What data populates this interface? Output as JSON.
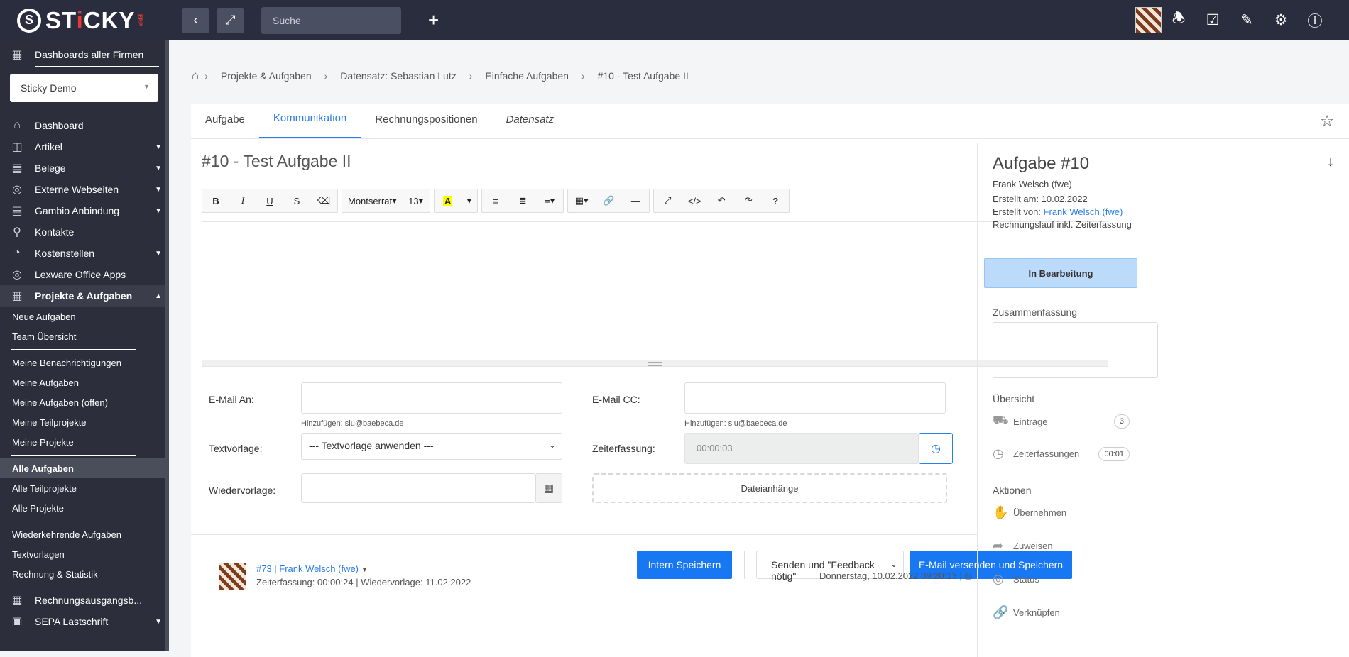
{
  "topbar": {
    "logo_text_a": "ST",
    "logo_text_b": "i",
    "logo_text_c": "CKY",
    "logo_suffix": "ERP",
    "search_placeholder": "Suche"
  },
  "sidebar": {
    "dashboards_all": "Dashboards aller Firmen",
    "company": "Sticky Demo",
    "items": [
      {
        "label": "Dashboard",
        "icon": "home-icon"
      },
      {
        "label": "Artikel",
        "icon": "box-icon"
      },
      {
        "label": "Belege",
        "icon": "document-icon"
      },
      {
        "label": "Externe Webseiten",
        "icon": "globe-icon"
      },
      {
        "label": "Gambio Anbindung",
        "icon": "document-icon"
      },
      {
        "label": "Kontakte",
        "icon": "contact-icon"
      },
      {
        "label": "Kostenstellen",
        "icon": "pie-chart-icon"
      },
      {
        "label": "Lexware Office Apps",
        "icon": "globe-icon"
      },
      {
        "label": "Projekte & Aufgaben",
        "icon": "notebook-icon"
      }
    ],
    "sub_group1": [
      "Neue Aufgaben",
      "Team Übersicht"
    ],
    "sub_group2": [
      "Meine Benachrichtigungen",
      "Meine Aufgaben",
      "Meine Aufgaben (offen)",
      "Meine Teilprojekte",
      "Meine Projekte"
    ],
    "sub_group3": [
      "Alle Aufgaben",
      "Alle Teilprojekte",
      "Alle Projekte"
    ],
    "sub_group4": [
      "Wiederkehrende Aufgaben",
      "Textvorlagen",
      "Rechnung & Statistik"
    ],
    "bottom_items": [
      {
        "label": "Rechnungsausgangsb...",
        "icon": "table-icon"
      },
      {
        "label": "SEPA Lastschrift",
        "icon": "card-icon"
      }
    ]
  },
  "breadcrumb": [
    "Projekte & Aufgaben",
    "Datensatz: Sebastian Lutz",
    "Einfache Aufgaben",
    "#10 - Test Aufgabe II"
  ],
  "tabs": [
    "Aufgabe",
    "Kommunikation",
    "Rechnungspositionen",
    "Datensatz"
  ],
  "task_title": "#10 - Test Aufgabe II",
  "toolbar": {
    "font": "Montserrat",
    "size": "13",
    "bold": "B",
    "italic": "I",
    "underline": "U",
    "strike": "S",
    "color": "A",
    "code": "</>",
    "help": "?"
  },
  "form": {
    "email_to_label": "E-Mail An:",
    "email_to_hint": "Hinzufügen: slu@baebeca.de",
    "email_cc_label": "E-Mail CC:",
    "email_cc_hint": "Hinzufügen: slu@baebeca.de",
    "template_label": "Textvorlage:",
    "template_value": "--- Textvorlage anwenden ---",
    "time_label": "Zeiterfassung:",
    "time_value": "00:00:03",
    "resub_label": "Wiedervorlage:",
    "attachments": "Dateianhänge",
    "save_internal": "Intern Speichern",
    "send_option": "Senden und \"Feedback nötig\"",
    "send_save": "E-Mail versenden und Speichern"
  },
  "comment": {
    "header": "#73 | Frank Welsch (fwe)",
    "meta": "Zeiterfassung: 00:00:24 | Wiedervorlage: 11.02.2022",
    "date": "Donnerstag, 10.02.2022 09:20:13 |"
  },
  "right_panel": {
    "title": "Aufgabe #10",
    "owner": "Frank Welsch (fwe)",
    "created_at": "Erstellt am: 10.02.2022",
    "created_by_label": "Erstellt von:",
    "created_by": "Frank Welsch (fwe)",
    "billing": "Rechnungslauf inkl. Zeiterfassung",
    "status": "In Bearbeitung",
    "summary_label": "Zusammenfassung",
    "overview_label": "Übersicht",
    "entries_label": "Einträge",
    "entries_count": "3",
    "time_label": "Zeiterfassungen",
    "time_count": "00:01",
    "actions_label": "Aktionen",
    "actions": [
      "Übernehmen",
      "Zuweisen",
      "Status",
      "Verknüpfen"
    ]
  }
}
